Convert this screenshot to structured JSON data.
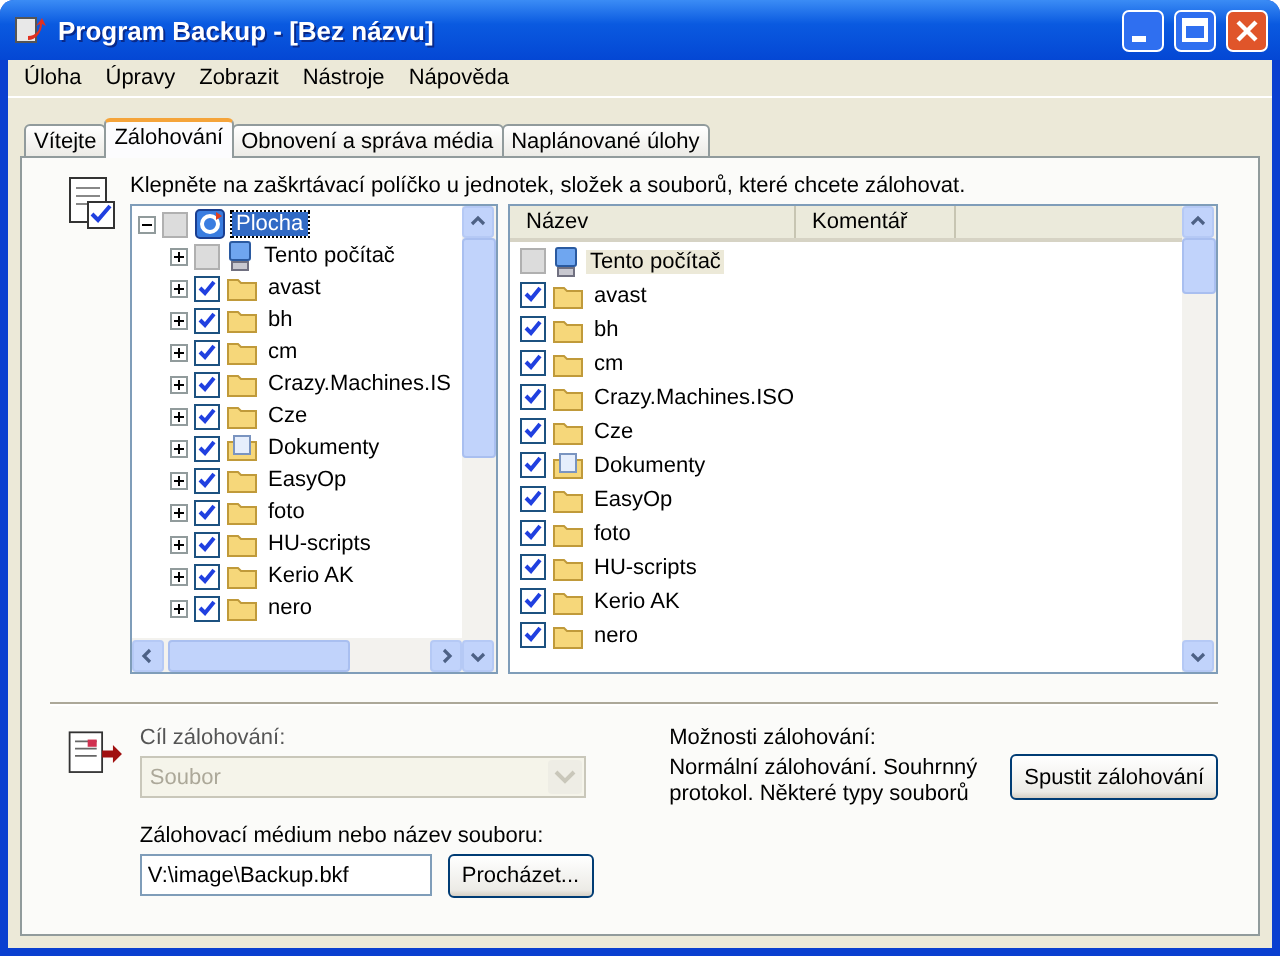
{
  "window": {
    "title": "Program Backup - [Bez názvu]"
  },
  "menu": [
    "Úloha",
    "Úpravy",
    "Zobrazit",
    "Nástroje",
    "Nápověda"
  ],
  "tabs": [
    {
      "label": "Vítejte",
      "selected": false
    },
    {
      "label": "Zálohování",
      "selected": true
    },
    {
      "label": "Obnovení a správa média",
      "selected": false
    },
    {
      "label": "Naplánované úlohy",
      "selected": false
    }
  ],
  "instruction": "Klepněte na zaškrtávací políčko u jednotek, složek a souborů, které chcete zálohovat.",
  "tree": [
    {
      "label": "Plocha",
      "kind": "desktop",
      "checked": false,
      "selected": true,
      "expanded": true,
      "children": [
        {
          "label": "Tento počítač",
          "kind": "computer",
          "checked": false,
          "selected": false,
          "expanded": false
        },
        {
          "label": "avast",
          "kind": "folder",
          "checked": true,
          "selected": false,
          "expanded": false
        },
        {
          "label": "bh",
          "kind": "folder",
          "checked": true,
          "selected": false,
          "expanded": false
        },
        {
          "label": "cm",
          "kind": "folder",
          "checked": true,
          "selected": false,
          "expanded": false
        },
        {
          "label": "Crazy.Machines.IS",
          "kind": "folder",
          "checked": true,
          "selected": false,
          "expanded": false
        },
        {
          "label": "Cze",
          "kind": "folder",
          "checked": true,
          "selected": false,
          "expanded": false
        },
        {
          "label": "Dokumenty",
          "kind": "documents",
          "checked": true,
          "selected": false,
          "expanded": false
        },
        {
          "label": "EasyOp",
          "kind": "folder",
          "checked": true,
          "selected": false,
          "expanded": false
        },
        {
          "label": "foto",
          "kind": "folder",
          "checked": true,
          "selected": false,
          "expanded": false
        },
        {
          "label": "HU-scripts",
          "kind": "folder",
          "checked": true,
          "selected": false,
          "expanded": false
        },
        {
          "label": "Kerio AK",
          "kind": "folder",
          "checked": true,
          "selected": false,
          "expanded": false
        },
        {
          "label": "nero",
          "kind": "folder",
          "checked": true,
          "selected": false,
          "expanded": false
        }
      ]
    }
  ],
  "list": {
    "columns": [
      "Název",
      "Komentář"
    ],
    "rows": [
      {
        "name": "Tento počítač",
        "kind": "computer",
        "checked": false,
        "selected": true
      },
      {
        "name": "avast",
        "kind": "folder",
        "checked": true,
        "selected": false
      },
      {
        "name": "bh",
        "kind": "folder",
        "checked": true,
        "selected": false
      },
      {
        "name": "cm",
        "kind": "folder",
        "checked": true,
        "selected": false
      },
      {
        "name": "Crazy.Machines.ISO",
        "kind": "folder",
        "checked": true,
        "selected": false
      },
      {
        "name": "Cze",
        "kind": "folder",
        "checked": true,
        "selected": false
      },
      {
        "name": "Dokumenty",
        "kind": "documents",
        "checked": true,
        "selected": false
      },
      {
        "name": "EasyOp",
        "kind": "folder",
        "checked": true,
        "selected": false
      },
      {
        "name": "foto",
        "kind": "folder",
        "checked": true,
        "selected": false
      },
      {
        "name": "HU-scripts",
        "kind": "folder",
        "checked": true,
        "selected": false
      },
      {
        "name": "Kerio AK",
        "kind": "folder",
        "checked": true,
        "selected": false
      },
      {
        "name": "nero",
        "kind": "folder",
        "checked": true,
        "selected": false
      }
    ]
  },
  "destination": {
    "label": "Cíl zálohování:",
    "value": "Soubor",
    "disabled": true
  },
  "media": {
    "label": "Zálohovací médium nebo název souboru:",
    "value": "V:\\image\\Backup.bkf",
    "browse_button": "Procházet..."
  },
  "options": {
    "label": "Možnosti zálohování:",
    "text": "Normální zálohování. Souhrnný protokol. Některé typy souborů"
  },
  "start_button": "Spustit zálohování"
}
